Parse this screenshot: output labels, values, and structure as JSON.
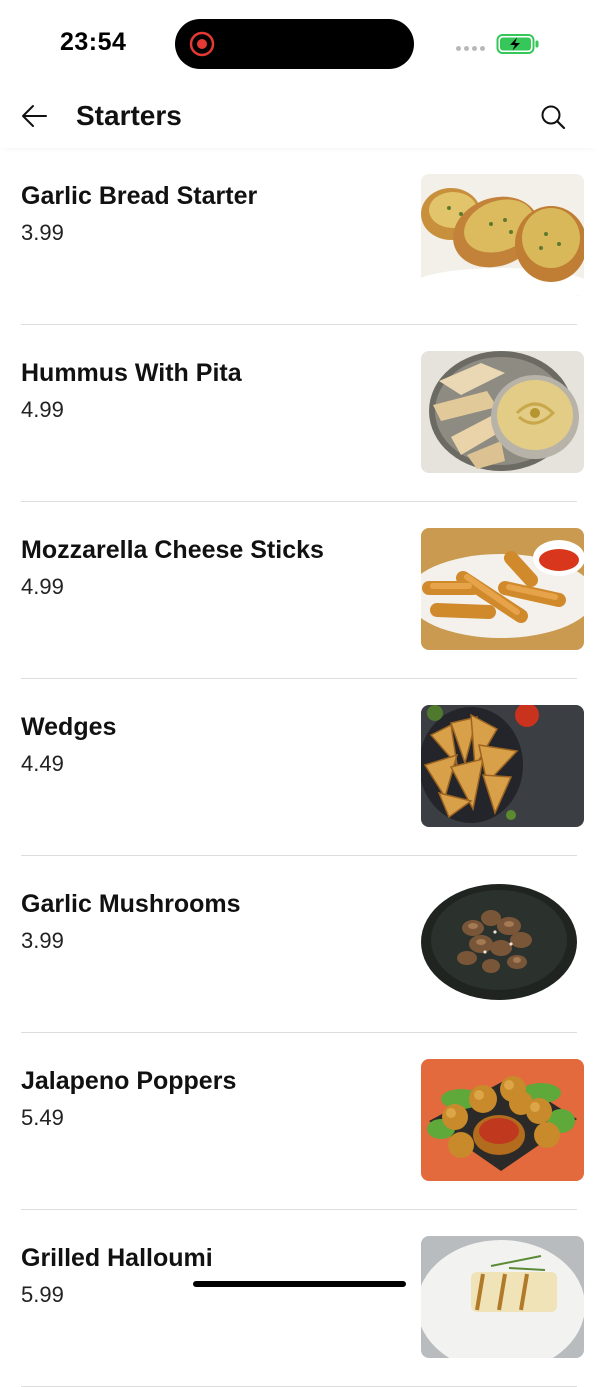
{
  "status_bar": {
    "time": "23:54",
    "icons": [
      "screen-recording-icon",
      "signal-icon",
      "battery-charging-icon"
    ],
    "colors": {
      "record": "#e53935",
      "battery": "#35c759"
    }
  },
  "header": {
    "title": "Starters",
    "back_icon": "arrow-left-icon",
    "search_icon": "search-icon"
  },
  "menu_items": [
    {
      "name": "Garlic Bread Starter",
      "price": "3.99",
      "image": "garlic-bread-photo"
    },
    {
      "name": "Hummus With Pita",
      "price": "4.99",
      "image": "hummus-pita-photo"
    },
    {
      "name": "Mozzarella Cheese Sticks",
      "price": "4.99",
      "image": "mozzarella-sticks-photo"
    },
    {
      "name": "Wedges",
      "price": "4.49",
      "image": "potato-wedges-photo"
    },
    {
      "name": "Garlic Mushrooms",
      "price": "3.99",
      "image": "garlic-mushrooms-photo"
    },
    {
      "name": "Jalapeno Poppers",
      "price": "5.49",
      "image": "jalapeno-poppers-photo"
    },
    {
      "name": "Grilled Halloumi",
      "price": "5.99",
      "image": "grilled-halloumi-photo"
    }
  ]
}
